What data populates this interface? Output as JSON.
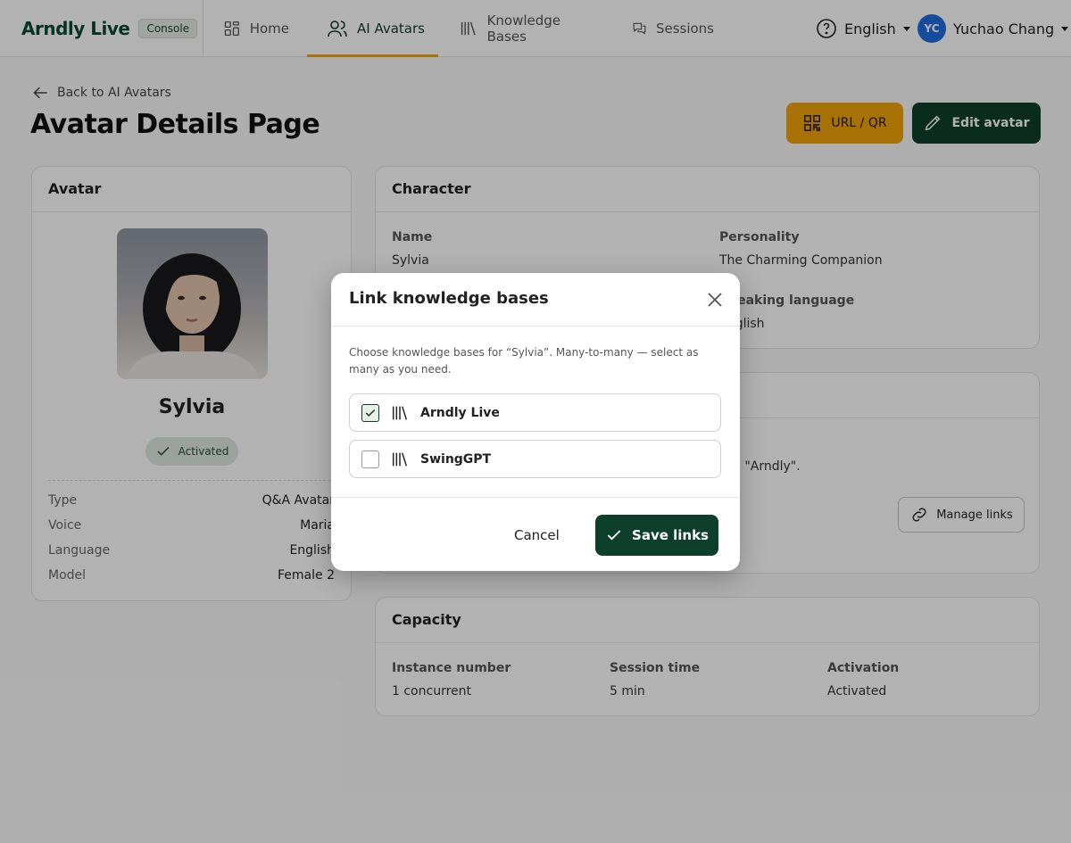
{
  "header": {
    "logo_text": "Arndly Live",
    "console_badge": "Console",
    "nav": [
      {
        "label": "Home"
      },
      {
        "label": "AI Avatars"
      },
      {
        "label": "Knowledge Bases"
      },
      {
        "label": "Sessions"
      }
    ],
    "language": "English",
    "user": {
      "initials": "YC",
      "name": "Yuchao Chang"
    }
  },
  "page": {
    "back_label": "Back to AI Avatars",
    "title": "Avatar Details Page",
    "url_qr_label": "URL / QR",
    "edit_label": "Edit avatar"
  },
  "avatar_card": {
    "title": "Avatar",
    "name": "Sylvia",
    "status": "Activated",
    "details": [
      {
        "key": "Type",
        "value": "Q&A Avatar"
      },
      {
        "key": "Voice",
        "value": "Maria"
      },
      {
        "key": "Language",
        "value": "English"
      },
      {
        "key": "Model",
        "value": "Female 2"
      }
    ]
  },
  "character_card": {
    "title": "Character",
    "name_label": "Name",
    "name_value": "Sylvia",
    "personality_label": "Personality",
    "personality_value": "The Charming Companion",
    "speaking_label": "Speaking language",
    "speaking_value": "English"
  },
  "kb_card": {
    "text_visible": "d \"Arndly\".",
    "manage_label": "Manage links"
  },
  "capacity_card": {
    "title": "Capacity",
    "fields": [
      {
        "label": "Instance number",
        "value": "1 concurrent"
      },
      {
        "label": "Session time",
        "value": "5 min"
      },
      {
        "label": "Activation",
        "value": "Activated"
      }
    ]
  },
  "modal": {
    "title": "Link knowledge bases",
    "description": "Choose knowledge bases for “Sylvia”. Many-to-many — select as many as you need.",
    "options": [
      {
        "label": "Arndly Live",
        "checked": true
      },
      {
        "label": "SwingGPT",
        "checked": false
      }
    ],
    "cancel_label": "Cancel",
    "save_label": "Save links"
  },
  "icons": {
    "home": "grid-icon",
    "avatars": "users-icon",
    "kb": "library-icon",
    "sessions": "chat-icon",
    "help": "help-circle-icon",
    "qr": "qr-icon",
    "edit": "pencil-icon",
    "link": "link-icon",
    "check": "check-icon",
    "close": "close-icon"
  },
  "colors": {
    "brand_dark": "#0e3f2b",
    "accent": "#f0a30a",
    "user_avatar": "#1f6fe0"
  }
}
